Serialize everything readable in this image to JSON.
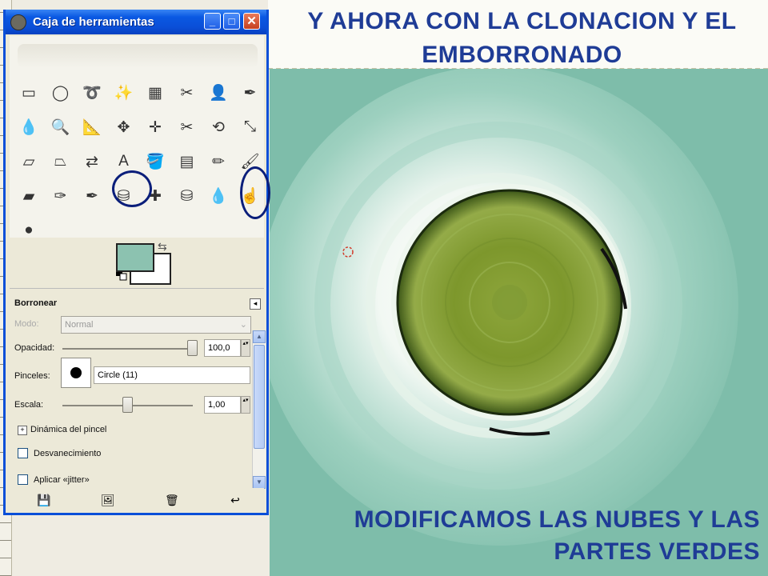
{
  "slide": {
    "title": "Y AHORA CON LA CLONACION Y EL EMBORRONADO",
    "caption": "MODIFICAMOS LAS NUBES Y LAS PARTES VERDES"
  },
  "window": {
    "title": "Caja de herramientas",
    "buttons": {
      "minimize": "_",
      "maximize": "□",
      "close": "✕"
    }
  },
  "colors": {
    "foreground": "#8cc2b0",
    "background": "#ffffff",
    "accent": "#0a4fd8",
    "slide_text": "#1f3c96"
  },
  "tools": [
    {
      "icon": "rect-select-icon",
      "glyph": "▭"
    },
    {
      "icon": "ellipse-select-icon",
      "glyph": "◯"
    },
    {
      "icon": "free-select-icon",
      "glyph": "➰"
    },
    {
      "icon": "fuzzy-select-icon",
      "glyph": "✨"
    },
    {
      "icon": "color-select-icon",
      "glyph": "▦"
    },
    {
      "icon": "scissors-icon",
      "glyph": "✂"
    },
    {
      "icon": "foreground-select-icon",
      "glyph": "👤"
    },
    {
      "icon": "paths-icon",
      "glyph": "✒"
    },
    {
      "icon": "color-picker-icon",
      "glyph": "💧"
    },
    {
      "icon": "zoom-icon",
      "glyph": "🔍"
    },
    {
      "icon": "measure-icon",
      "glyph": "📐"
    },
    {
      "icon": "move-icon",
      "glyph": "✥"
    },
    {
      "icon": "align-icon",
      "glyph": "✛"
    },
    {
      "icon": "crop-icon",
      "glyph": "✂"
    },
    {
      "icon": "rotate-icon",
      "glyph": "⟲"
    },
    {
      "icon": "scale-icon",
      "glyph": "⤡"
    },
    {
      "icon": "shear-icon",
      "glyph": "▱"
    },
    {
      "icon": "perspective-icon",
      "glyph": "⏢"
    },
    {
      "icon": "flip-icon",
      "glyph": "⇄"
    },
    {
      "icon": "text-icon",
      "glyph": "A"
    },
    {
      "icon": "bucket-fill-icon",
      "glyph": "🪣"
    },
    {
      "icon": "blend-icon",
      "glyph": "▤"
    },
    {
      "icon": "pencil-icon",
      "glyph": "✏"
    },
    {
      "icon": "paintbrush-icon",
      "glyph": "🖌"
    },
    {
      "icon": "eraser-icon",
      "glyph": "▰"
    },
    {
      "icon": "airbrush-icon",
      "glyph": "✑"
    },
    {
      "icon": "ink-icon",
      "glyph": "✒"
    },
    {
      "icon": "clone-icon",
      "glyph": "⛁"
    },
    {
      "icon": "heal-icon",
      "glyph": "✚"
    },
    {
      "icon": "perspective-clone-icon",
      "glyph": "⛁"
    },
    {
      "icon": "blur-sharpen-icon",
      "glyph": "💧"
    },
    {
      "icon": "smudge-icon",
      "glyph": "☝"
    },
    {
      "icon": "dodge-burn-icon",
      "glyph": "●"
    }
  ],
  "options": {
    "title": "Borronear",
    "menu_glyph": "◂",
    "mode_label": "Modo:",
    "mode_value": "Normal",
    "opacity_label": "Opacidad:",
    "opacity_value": "100,0",
    "opacity": 1.0,
    "brushes_label": "Pinceles:",
    "brush_name": "Circle (11)",
    "scale_label": "Escala:",
    "scale_value": "1,00",
    "scale_fraction": 0.5,
    "dynamics_label": "Dinámica del pincel",
    "fade_label": "Desvanecimiento",
    "jitter_label": "Aplicar «jitter»",
    "expander_glyph": "+",
    "spin_glyph": "▴▾",
    "scroll_up": "▲",
    "scroll_down": "▼"
  },
  "bottom_icons": [
    {
      "icon": "save-options-icon",
      "glyph": "💾"
    },
    {
      "icon": "restore-options-icon",
      "glyph": "🖼"
    },
    {
      "icon": "delete-options-icon",
      "glyph": "🗑"
    },
    {
      "icon": "reset-options-icon",
      "glyph": "↩"
    }
  ]
}
